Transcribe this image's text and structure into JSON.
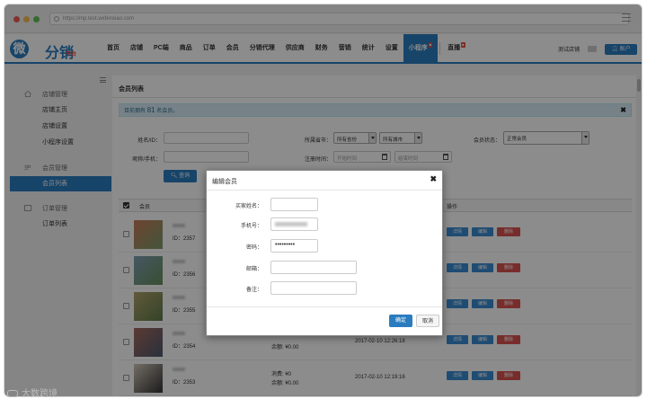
{
  "browser": {
    "url": "https://mp.test.wxfenxiao.com"
  },
  "logo": {
    "main": "微分销",
    "circle": "微",
    "sub": "平台"
  },
  "topnav": {
    "items": [
      "首页",
      "店铺",
      "PC端",
      "商品",
      "订单",
      "会员",
      "分销代理",
      "供应商",
      "财务",
      "营销",
      "统计",
      "设置",
      "小程序",
      "直播"
    ],
    "active": "小程序",
    "store_label": "测试店铺",
    "account_label": "账户"
  },
  "sidebar": {
    "groups": [
      {
        "label": "店铺管理",
        "icon": "home-icon",
        "items": [
          "店铺主页",
          "店铺设置",
          "小程序设置"
        ]
      },
      {
        "label": "会员管理",
        "icon": "users-icon",
        "items": [
          "会员列表"
        ]
      },
      {
        "label": "订单管理",
        "icon": "checkbox-icon",
        "items": [
          "订单列表"
        ]
      }
    ],
    "active_item": "会员列表"
  },
  "main": {
    "title": "会员列表",
    "alert_prefix": "目前拥有",
    "alert_count": "81",
    "alert_suffix": "名会员。",
    "filters": {
      "name_label": "姓名/ID：",
      "nick_label": "昵称/手机：",
      "region_label": "所属省市：",
      "province": "所有省份",
      "city": "所有城市",
      "reg_time_label": "注册时间：",
      "start_placeholder": "开始时间",
      "end_placeholder": "结束时间",
      "status_label": "会员状态：",
      "status_value": "正常会员",
      "query_button": "查询"
    },
    "table": {
      "col_member": "会员",
      "col_ops": "操作",
      "rows": [
        {
          "id": "ID：2357",
          "stat_line1": "",
          "stat_line2": "",
          "time": ""
        },
        {
          "id": "ID：2356",
          "stat_line1": "",
          "stat_line2": "",
          "time": ""
        },
        {
          "id": "ID：2355",
          "stat_line1": "",
          "stat_line2": "",
          "time": ""
        },
        {
          "id": "ID：2354",
          "stat_line1": "",
          "stat_line2": "余额: ¥0.00",
          "time": "2017-02-10 12:26:18"
        },
        {
          "id": "ID：2353",
          "stat_line1": "消费: ¥0",
          "stat_line2": "余额: ¥0.00",
          "time": "2017-02-10 12:19:16"
        }
      ],
      "op_detail": "详情",
      "op_edit": "编辑",
      "op_delete": "删除"
    }
  },
  "modal": {
    "title": "编辑会员",
    "fields": [
      {
        "label": "买家姓名：",
        "value": ""
      },
      {
        "label": "手机号：",
        "value": ""
      },
      {
        "label": "密码：",
        "value": "•••••••••"
      },
      {
        "label": "邮箱：",
        "value": ""
      },
      {
        "label": "备注：",
        "value": ""
      }
    ],
    "ok_button": "确定",
    "cancel_button": "取消"
  },
  "watermark": "大数跨境"
}
